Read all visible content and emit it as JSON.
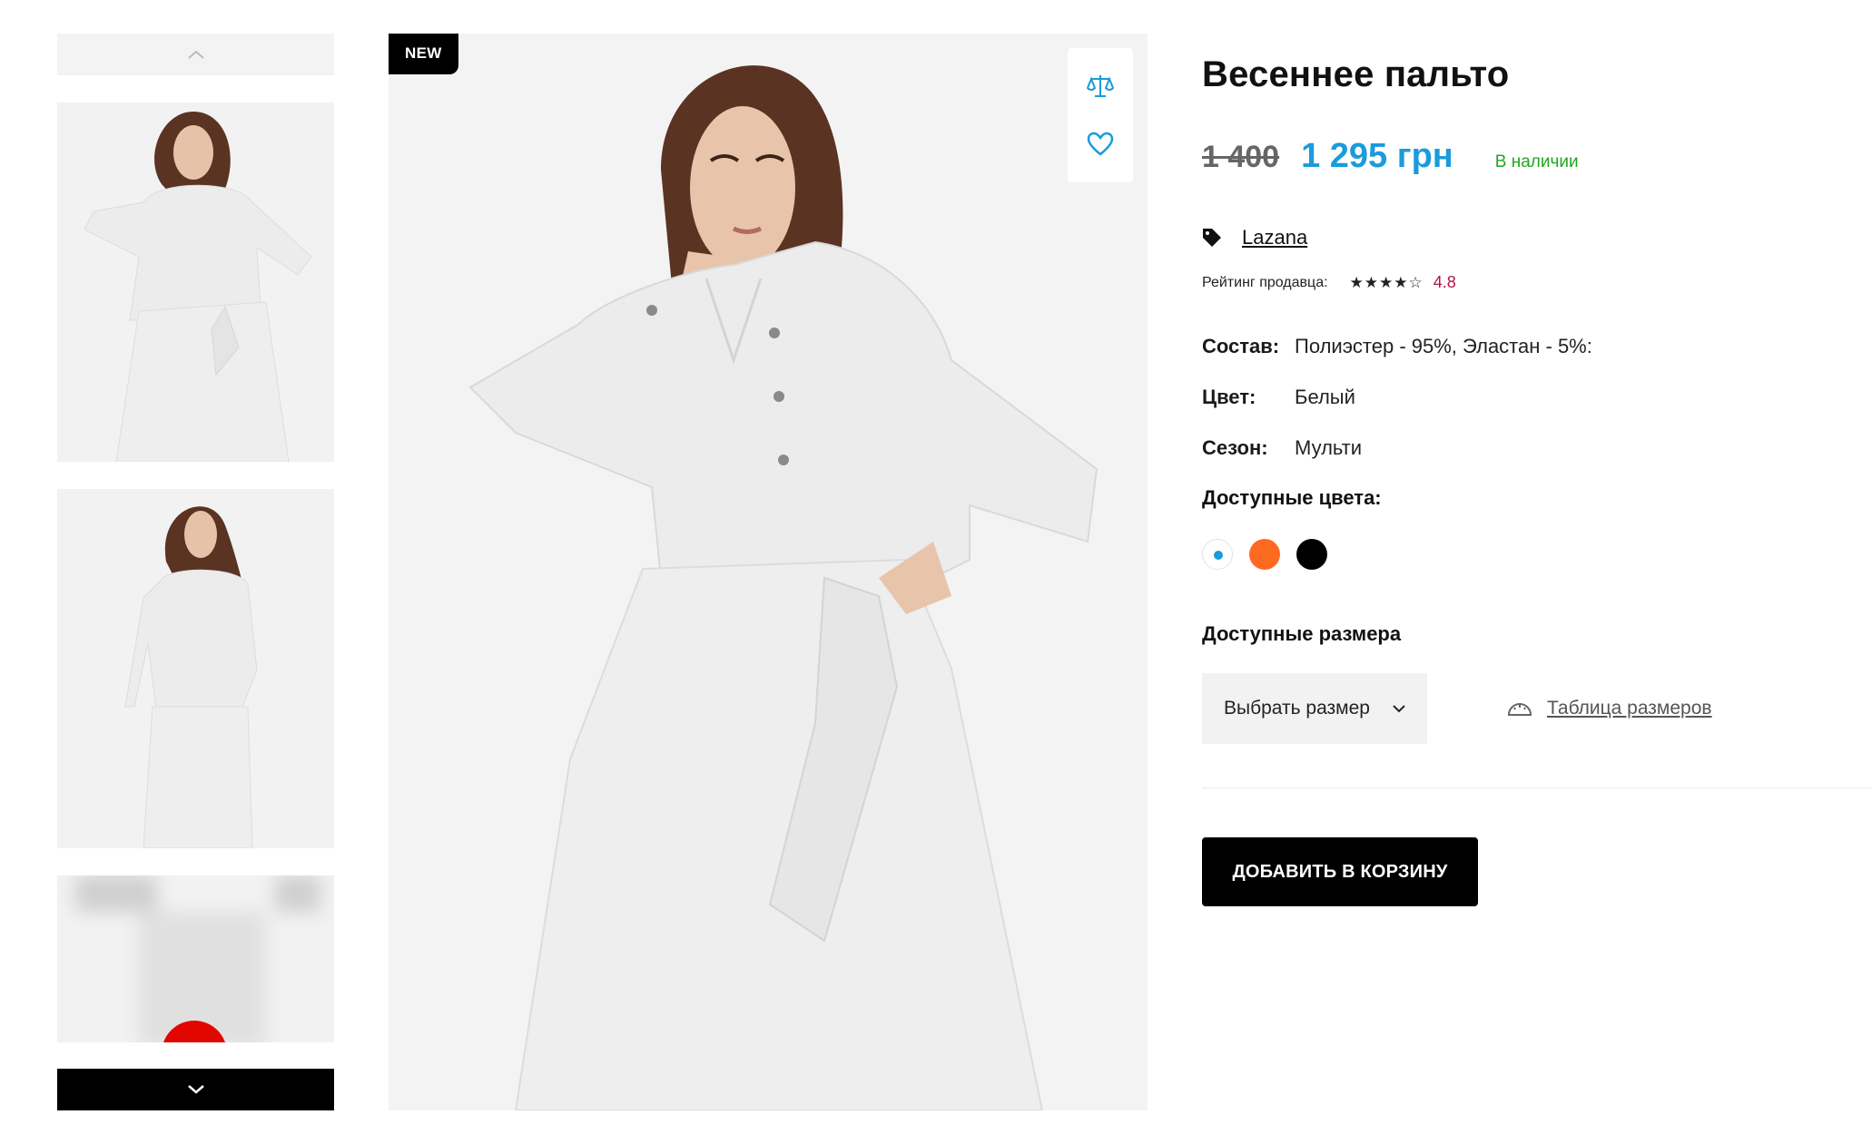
{
  "badge": "NEW",
  "product": {
    "title": "Весеннее пальто",
    "old_price": "1 400",
    "price": "1 295 грн",
    "stock": "В наличии",
    "brand": "Lazana",
    "rating_label": "Рейтинг продавца:",
    "rating_value": "4.8",
    "rating_stars": 4
  },
  "props": [
    {
      "k": "Состав:",
      "v": "Полиэстер - 95%, Эластан - 5%:"
    },
    {
      "k": "Цвет:",
      "v": "Белый"
    },
    {
      "k": "Сезон:",
      "v": "Мульти"
    }
  ],
  "colors_title": "Доступные цвета:",
  "colors": [
    "#ffffff",
    "#ff6a21",
    "#000000"
  ],
  "selected_color_dot": "#1a9bdc",
  "sizes_title": "Доступные размера",
  "size_select": "Выбрать размер",
  "size_table": "Таблица размеров",
  "cart_button": "ДОБАВИТЬ В КОРЗИНУ",
  "accent_color": "#1a9bdc",
  "stock_color": "#1fa81f",
  "icons": {
    "compare": "scales-icon",
    "favorite": "heart-icon",
    "brand": "tag-icon",
    "size_table": "ruler-icon"
  }
}
